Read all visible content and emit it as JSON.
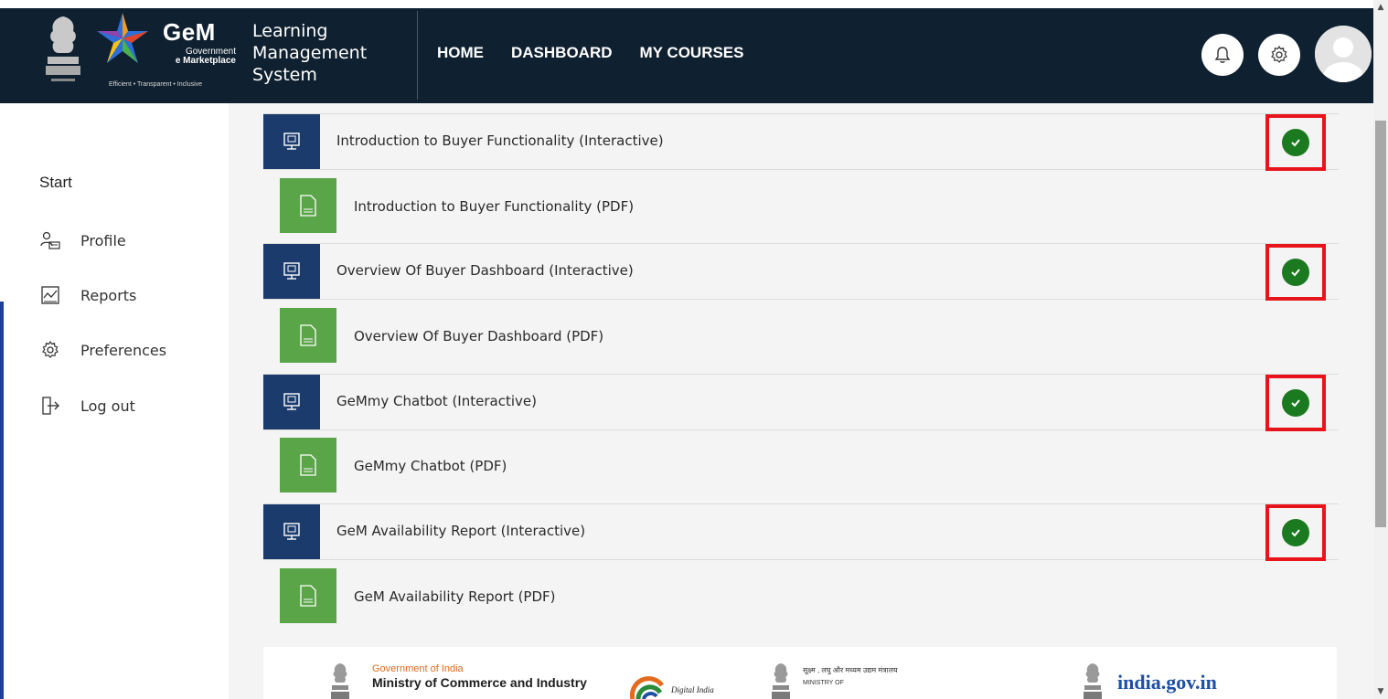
{
  "header": {
    "brand": {
      "name": "GeM",
      "sub_line1": "Government",
      "sub_line2": "e Marketplace",
      "tagline": "Efficient • Transparent • Inclusive"
    },
    "app_title": "Learning\nManagement\nSystem",
    "nav": [
      {
        "label": "HOME"
      },
      {
        "label": "DASHBOARD"
      },
      {
        "label": "MY COURSES"
      }
    ],
    "icons": [
      "bell-icon",
      "gear-icon",
      "avatar"
    ]
  },
  "sidebar": {
    "start_label": "Start",
    "items": [
      {
        "label": "Profile",
        "icon": "profile-icon"
      },
      {
        "label": "Reports",
        "icon": "reports-icon"
      },
      {
        "label": "Preferences",
        "icon": "gear-icon"
      },
      {
        "label": "Log out",
        "icon": "logout-icon"
      }
    ]
  },
  "modules": [
    {
      "interactive": "Introduction to Buyer Functionality (Interactive)",
      "pdf": "Introduction to Buyer Functionality (PDF)",
      "completed": true
    },
    {
      "interactive": "Overview Of Buyer Dashboard (Interactive)",
      "pdf": "Overview Of Buyer Dashboard (PDF)",
      "completed": true
    },
    {
      "interactive": "GeMmy Chatbot (Interactive)",
      "pdf": "GeMmy Chatbot (PDF)",
      "completed": true
    },
    {
      "interactive": "GeM Availability Report (Interactive)",
      "pdf": "GeM Availability Report (PDF)",
      "completed": true
    }
  ],
  "footer": {
    "goi": "Government of India",
    "ministry": "Ministry of Commerce and Industry",
    "digital_india": "Digital India",
    "msme_line1": "सूक्ष्म , लघु और मध्यम उद्यम मंत्रालय",
    "msme_line2": "MINISTRY OF",
    "india_gov": "india.gov.in"
  },
  "colors": {
    "header_bg": "#0f2030",
    "interactive_icon_bg": "#1a3b6b",
    "pdf_icon_bg": "#5aa548",
    "check_green": "#1b7a1f",
    "highlight_red": "#e8141c",
    "content_bg": "#f4f4f4"
  }
}
